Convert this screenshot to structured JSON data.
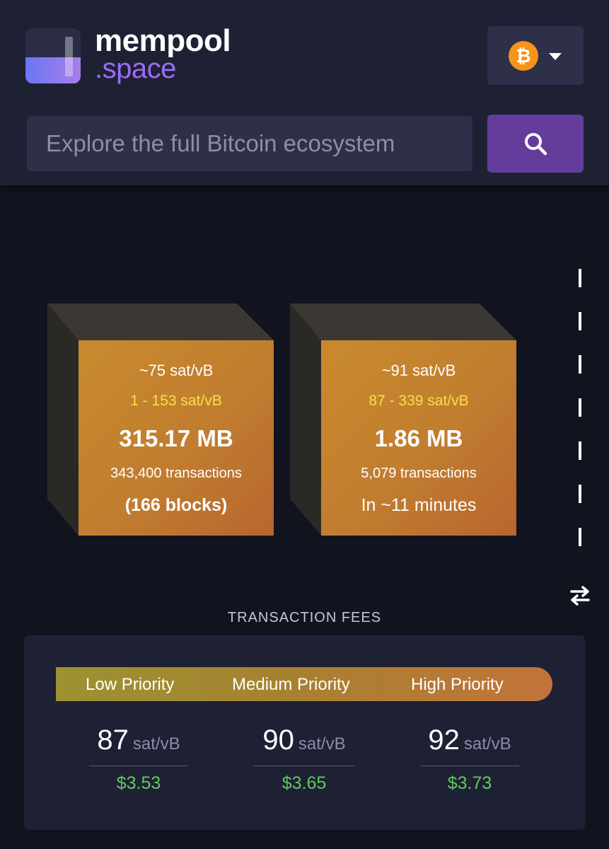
{
  "header": {
    "brand_line1": "mempool",
    "brand_line2": ".space",
    "network_icon": "bitcoin-icon",
    "search_placeholder": "Explore the full Bitcoin ecosystem",
    "search_icon": "search-icon"
  },
  "blocks": [
    {
      "median_fee": "~75 sat/vB",
      "fee_range": "1 - 153 sat/vB",
      "size": "315.17 MB",
      "tx_count": "343,400 transactions",
      "eta": "(166 blocks)"
    },
    {
      "median_fee": "~91 sat/vB",
      "fee_range": "87 - 339 sat/vB",
      "size": "1.86 MB",
      "tx_count": "5,079 transactions",
      "eta": "In ~11 minutes"
    }
  ],
  "fees": {
    "title": "TRANSACTION FEES",
    "priorities": [
      {
        "label": "Low Priority",
        "rate": "87",
        "unit": "sat/vB",
        "usd": "$3.53"
      },
      {
        "label": "Medium Priority",
        "rate": "90",
        "unit": "sat/vB",
        "usd": "$3.65"
      },
      {
        "label": "High Priority",
        "rate": "92",
        "unit": "sat/vB",
        "usd": "$3.73"
      }
    ]
  },
  "colors": {
    "accent": "#653b9c",
    "brand_purple": "#9b6cf5",
    "block_orange": "#c98a2e",
    "fee_range_yellow": "#f8e04a",
    "usd_green": "#5fcb5b"
  }
}
